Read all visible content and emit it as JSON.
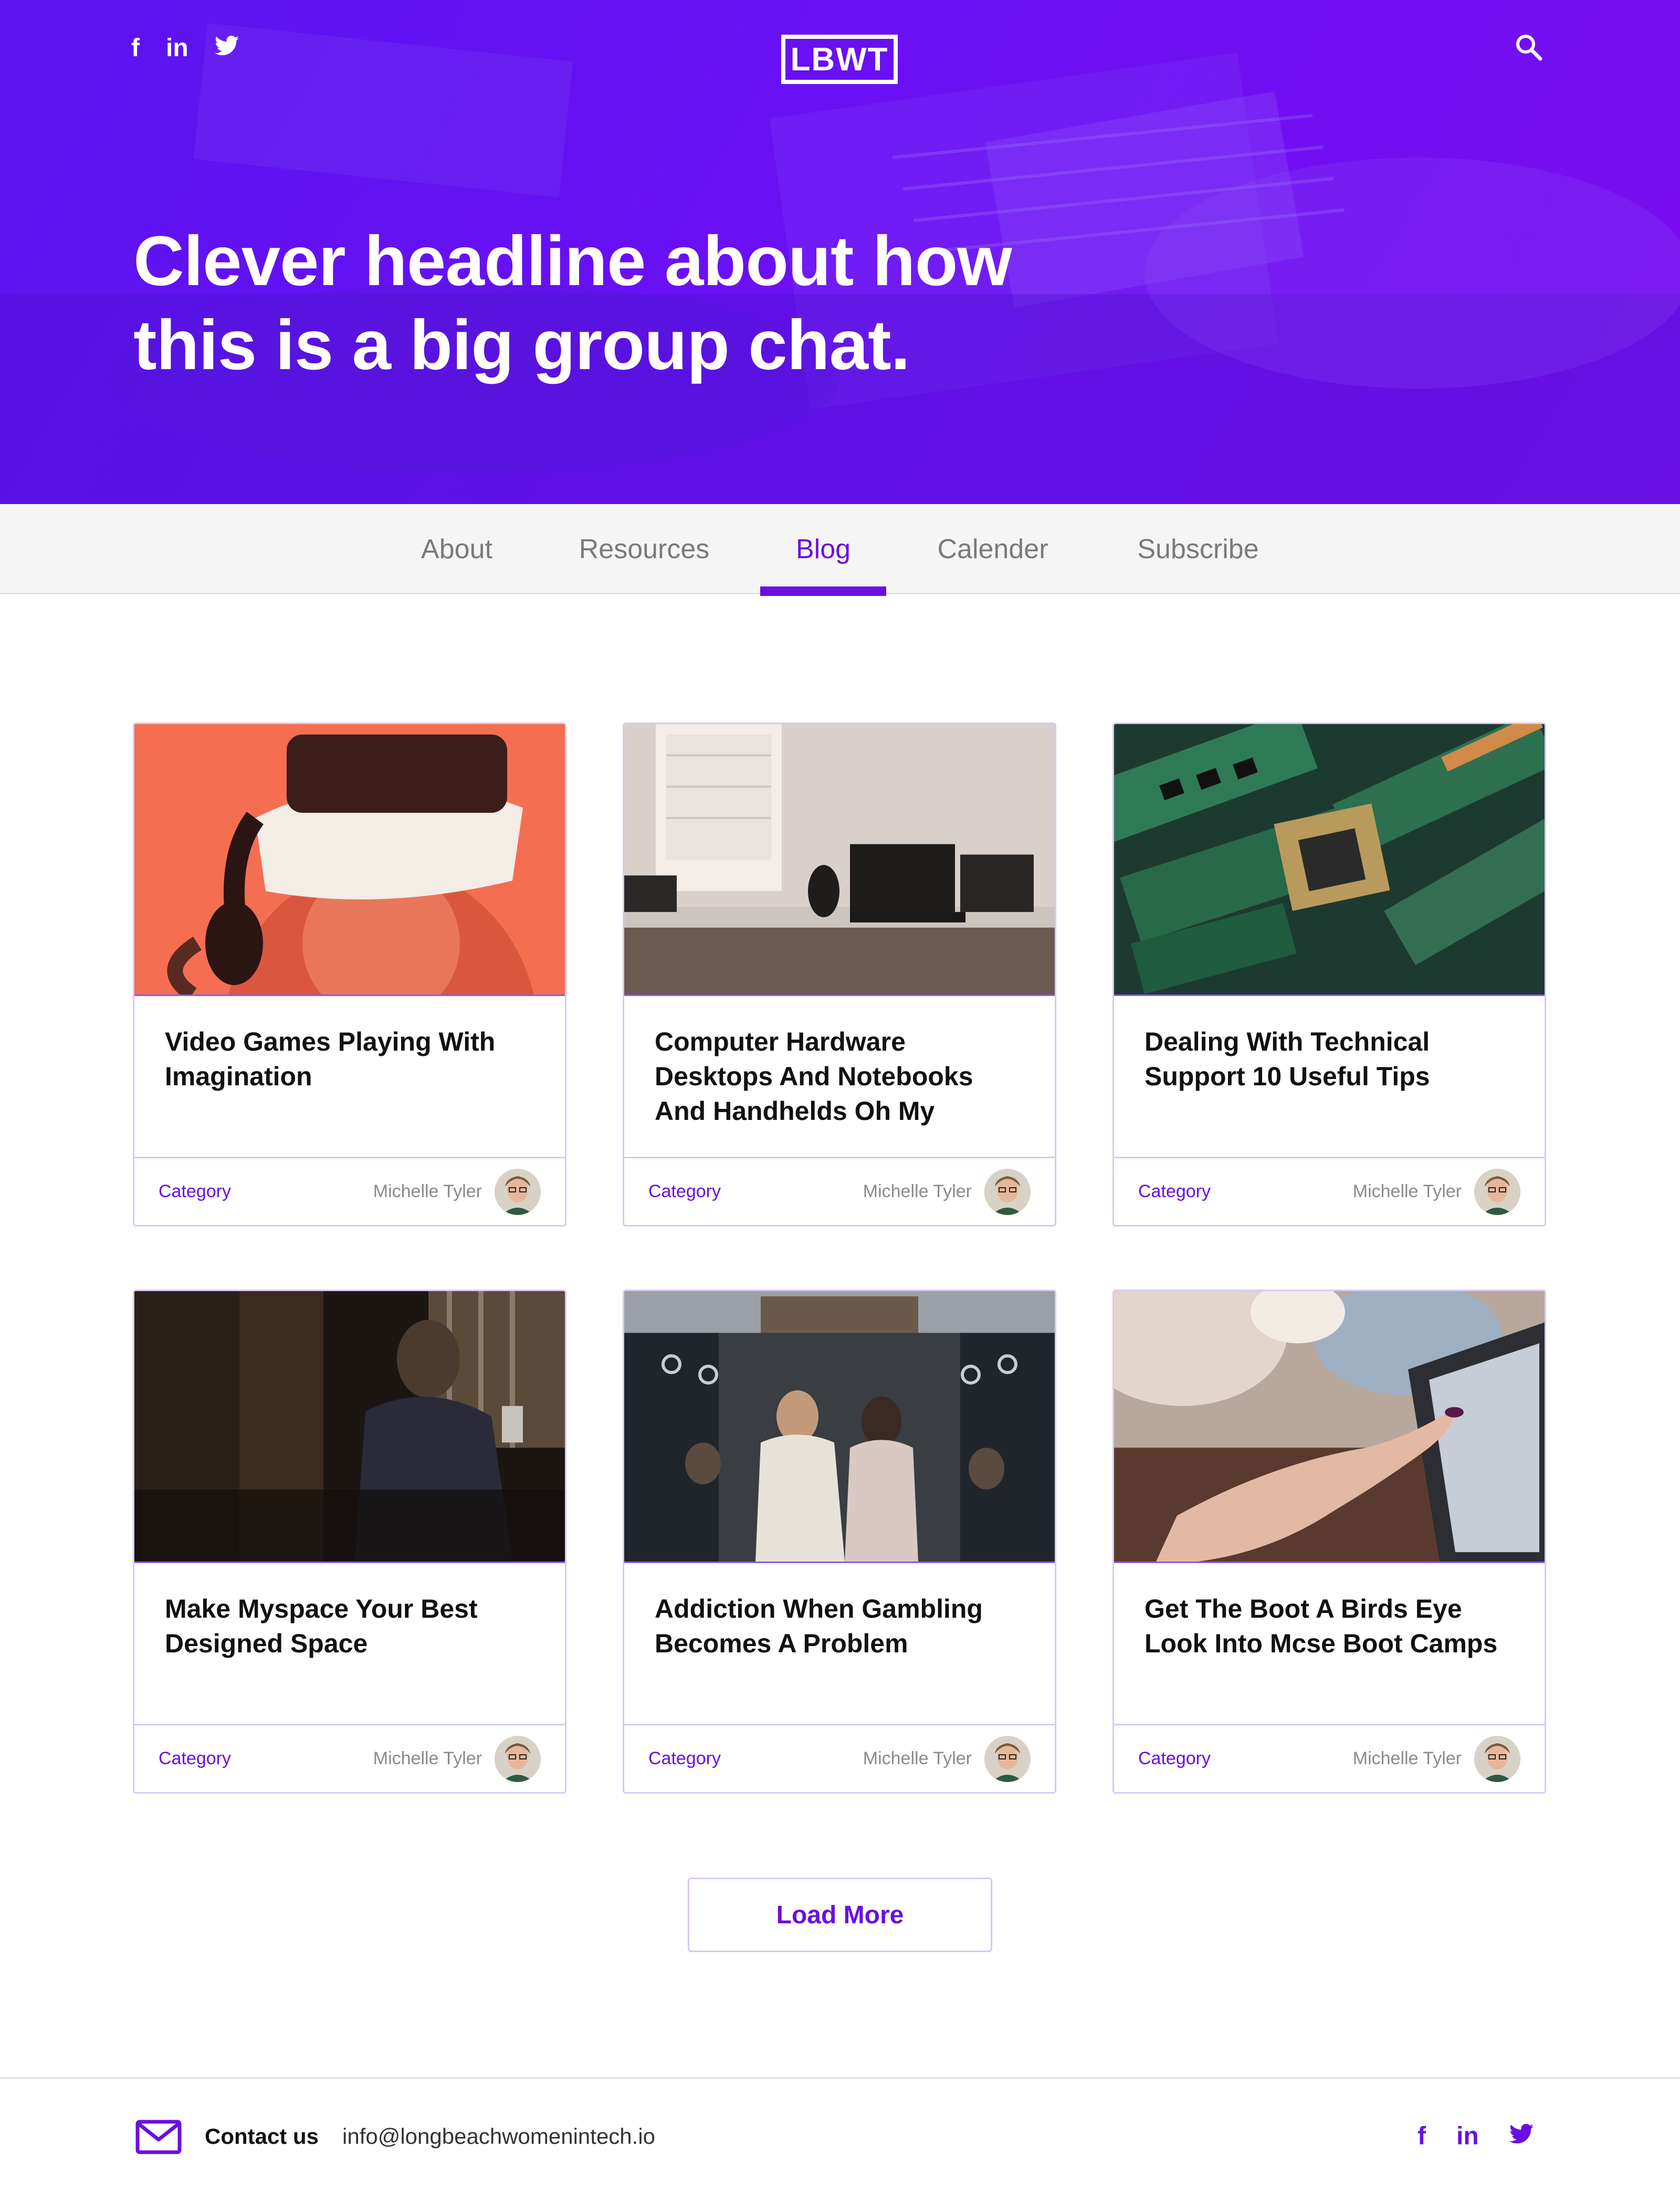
{
  "header": {
    "logo": "LBWT",
    "social": [
      "f",
      "in",
      "t"
    ],
    "headline_line1": "Clever headline about how",
    "headline_line2": "this is a big group chat."
  },
  "nav": {
    "tabs": [
      {
        "label": "About"
      },
      {
        "label": "Resources"
      },
      {
        "label": "Blog"
      },
      {
        "label": "Calender"
      },
      {
        "label": "Subscribe"
      }
    ],
    "active": "Blog"
  },
  "posts": [
    {
      "title": "Video Games Playing With Imagination",
      "category": "Category",
      "author": "Michelle Tyler",
      "image": "vr-headset-photo"
    },
    {
      "title": "Computer Hardware Desktops And Notebooks And Handhelds Oh My",
      "category": "Category",
      "author": "Michelle Tyler",
      "image": "desk-computers-photo"
    },
    {
      "title": "Dealing With Technical Support 10 Useful Tips",
      "category": "Category",
      "author": "Michelle Tyler",
      "image": "circuit-boards-photo"
    },
    {
      "title": "Make Myspace Your Best Designed Space",
      "category": "Category",
      "author": "Michelle Tyler",
      "image": "person-phone-photo"
    },
    {
      "title": "Addiction When Gambling Becomes A Problem",
      "category": "Category",
      "author": "Michelle Tyler",
      "image": "subway-crowd-photo"
    },
    {
      "title": "Get The Boot A Birds Eye Look Into Mcse Boot Camps",
      "category": "Category",
      "author": "Michelle Tyler",
      "image": "tablet-touch-photo"
    }
  ],
  "load_more_label": "Load More",
  "footer": {
    "contact_label": "Contact us",
    "email": "info@longbeachwomenintech.io",
    "social": [
      "f",
      "in",
      "t"
    ]
  },
  "colors": {
    "accent": "#6a0fe0",
    "hero_purple": "#5a14f0",
    "card_border": "#d9c9f5"
  }
}
